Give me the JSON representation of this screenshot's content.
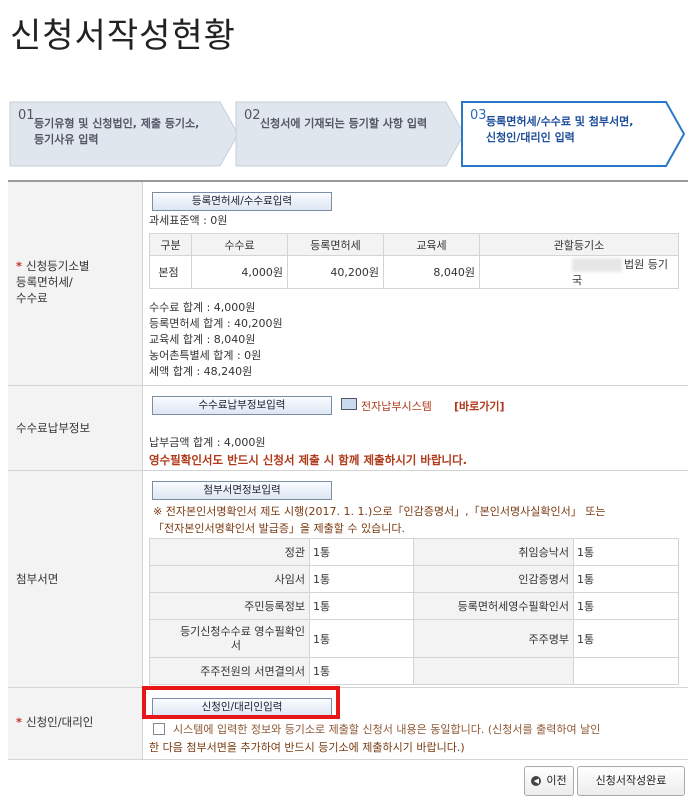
{
  "page": {
    "title": "신청서작성현황"
  },
  "steps": [
    {
      "num": "01",
      "text1": "등기유형 및 신청법인, 제출 등기소,",
      "text2": "등기사유 입력"
    },
    {
      "num": "02",
      "text1": "신청서에 기재되는 등기할 사항 입력",
      "text2": ""
    },
    {
      "num": "03",
      "text1": "등록면허세/수수료 및 첨부서면,",
      "text2": "신청인/대리인 입력"
    }
  ],
  "fee_section": {
    "label1": "신청등기소별",
    "label2": "등록면허세/",
    "label3": "수수료",
    "button": "등록면허세/수수료입력",
    "tax_base": "과세표준액 : 0원",
    "headers": [
      "구분",
      "수수료",
      "등록면허세",
      "교육세",
      "관할등기소"
    ],
    "row": {
      "type": "본점",
      "fee": "4,000원",
      "reg_tax": "40,200원",
      "edu_tax": "8,040원",
      "office": "법원 등기국"
    },
    "totals": [
      "수수료 합계 : 4,000원",
      "등록면허세 합계 : 40,200원",
      "교육세 합계 : 8,040원",
      "농어촌특별세 합계 : 0원",
      "세액 합계 : 48,240원"
    ]
  },
  "payment_section": {
    "label": "수수료납부정보",
    "button": "수수료납부정보입력",
    "system_text": "전자납부시스템",
    "shortcut": "[바로가기]",
    "amount": "납부금액 합계 : 4,000원",
    "warning": "영수필확인서도 반드시 신청서 제출 시 함께 제출하시기 바랍니다."
  },
  "attachment_section": {
    "label": "첨부서면",
    "button": "첨부서면정보입력",
    "note1": "※ 전자본인서명확인서 제도 시행(2017. 1. 1.)으로「인감증명서」,「본인서명사실확인서」 또는",
    "note2": "「전자본인서명확인서 발급증」을 제출할 수 있습니다.",
    "items": [
      {
        "name": "정관",
        "count": "1통",
        "name2": "취임승낙서",
        "count2": "1통"
      },
      {
        "name": "사임서",
        "count": "1통",
        "name2": "인감증명서",
        "count2": "1통"
      },
      {
        "name": "주민등록정보",
        "count": "1통",
        "name2": "등록면허세영수필확인서",
        "count2": "1통"
      },
      {
        "name": "등기신청수수료 영수필확인",
        "name_b": "서",
        "count": "1통",
        "name2": "주주명부",
        "count2": "1통"
      },
      {
        "name": "주주전원의 서면결의서",
        "count": "1통",
        "name2": "",
        "count2": ""
      }
    ]
  },
  "applicant_section": {
    "label": "신청인/대리인",
    "button": "신청인/대리인입력",
    "notice1": "시스템에 입력한 정보와 등기소로 제출할 신청서 내용은 동일합니다. (신청서를 출력하여 날인",
    "notice2": "한 다음 첨부서면을 추가하여 반드시 등기소에 제출하시기 바랍니다.)"
  },
  "footer": {
    "prev": "이전",
    "complete": "신청서작성완료"
  }
}
